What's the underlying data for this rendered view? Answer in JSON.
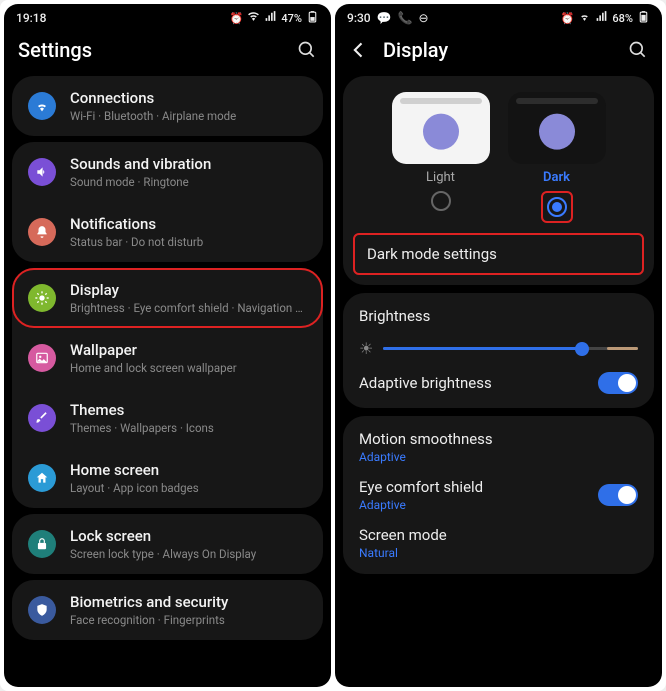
{
  "left": {
    "status": {
      "time": "19:18",
      "battery": "47%"
    },
    "title": "Settings",
    "items": [
      {
        "title": "Connections",
        "sub": "Wi-Fi · Bluetooth · Airplane mode",
        "color": "#2b7bd6"
      },
      {
        "title": "Sounds and vibration",
        "sub": "Sound mode · Ringtone",
        "color": "#7a4fd6"
      },
      {
        "title": "Notifications",
        "sub": "Status bar · Do not disturb",
        "color": "#d66a5a"
      },
      {
        "title": "Display",
        "sub": "Brightness · Eye comfort shield · Navigation bar",
        "color": "#7fb82e",
        "highlight": true
      },
      {
        "title": "Wallpaper",
        "sub": "Home and lock screen wallpaper",
        "color": "#d65aa0"
      },
      {
        "title": "Themes",
        "sub": "Themes · Wallpapers · Icons",
        "color": "#7a4fd6"
      },
      {
        "title": "Home screen",
        "sub": "Layout · App icon badges",
        "color": "#2b9bd6"
      },
      {
        "title": "Lock screen",
        "sub": "Screen lock type · Always On Display",
        "color": "#1f7f7a"
      },
      {
        "title": "Biometrics and security",
        "sub": "Face recognition · Fingerprints",
        "color": "#3a5a9e"
      }
    ]
  },
  "right": {
    "status": {
      "time": "9:30",
      "battery": "68%"
    },
    "title": "Display",
    "modes": {
      "light": "Light",
      "dark": "Dark"
    },
    "dark_mode_settings": "Dark mode settings",
    "brightness_label": "Brightness",
    "adaptive_brightness": "Adaptive brightness",
    "motion": {
      "title": "Motion smoothness",
      "sub": "Adaptive"
    },
    "eye": {
      "title": "Eye comfort shield",
      "sub": "Adaptive"
    },
    "screen_mode": {
      "title": "Screen mode",
      "sub": "Natural"
    }
  }
}
